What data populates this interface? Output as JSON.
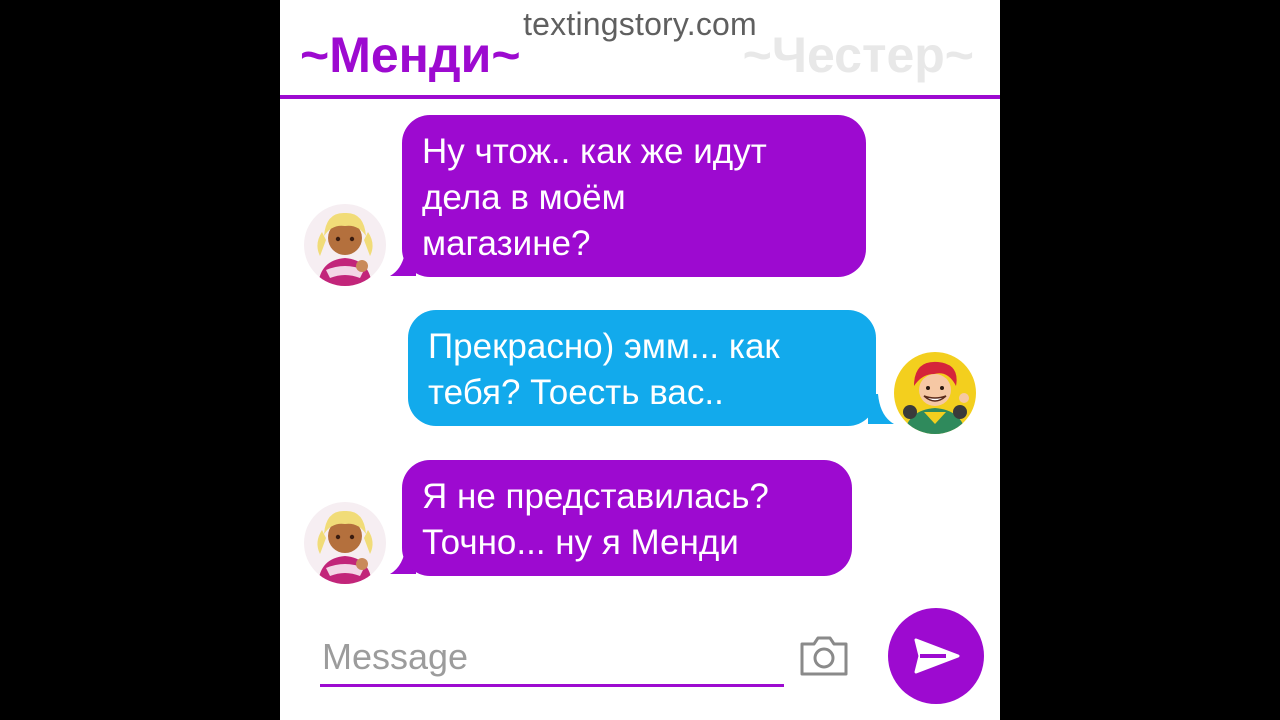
{
  "watermark": "textingstory.com",
  "header": {
    "left_name": "~Менди~",
    "right_name": "~Честер~"
  },
  "colors": {
    "accent": "#9d0ad0",
    "incoming_bubble": "#9d0ad0",
    "outgoing_bubble": "#12aaec",
    "inactive_name": "#e8e8e8",
    "placeholder": "#9c9c9c"
  },
  "messages": [
    {
      "sender": "Менди",
      "side": "left",
      "avatar": "mandy-avatar",
      "text": "Ну чтож.. как же идут\nдела в моём\nмагазине?"
    },
    {
      "sender": "Честер",
      "side": "right",
      "avatar": "chester-avatar",
      "text": "Прекрасно) эмм... как\nтебя? Тоесть вас.."
    },
    {
      "sender": "Менди",
      "side": "left",
      "avatar": "mandy-avatar",
      "text": "Я не представилась?\nТочно... ну я Менди"
    }
  ],
  "composer": {
    "placeholder": "Message",
    "camera_icon": "camera-icon",
    "send_icon": "send-icon"
  }
}
